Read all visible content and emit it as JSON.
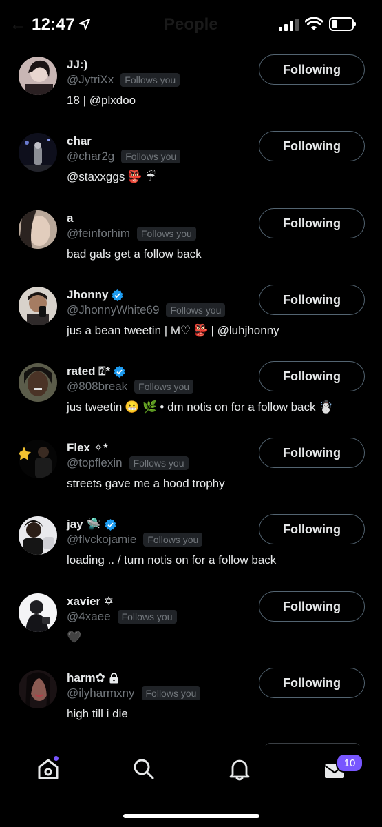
{
  "status_bar": {
    "time": "12:47",
    "title": "People"
  },
  "follow_label": "Following",
  "follows_you_label": "Follows you",
  "people": [
    {
      "name": "JJ:)",
      "handle": "@JytriXx",
      "bio": "18 | @plxdoo",
      "verified": false
    },
    {
      "name": "char",
      "handle": "@char2g",
      "bio": "@staxxggs",
      "bio_emoji": "👺 ☔",
      "verified": false
    },
    {
      "name": "a",
      "handle": "@feinforhim",
      "bio": "bad gals get a follow back",
      "verified": false
    },
    {
      "name": "Jhonny",
      "handle": "@JhonnyWhite69",
      "bio": "jus a bean tweetin | M♡",
      "bio_emoji": "👺",
      "bio_tail": "| @luhjhonny",
      "verified": true
    },
    {
      "name": "rated ⍰*",
      "handle": "@808break",
      "bio": "jus tweetin",
      "bio_emoji": "😬 🌿",
      "bio_tail": "• dm notis on for a follow back ☃️",
      "verified": true
    },
    {
      "name": "Flex ✧*",
      "handle": "@topflexin",
      "bio": "streets gave me a hood trophy",
      "verified": false
    },
    {
      "name": "jay 🛸",
      "handle": "@flvckojamie",
      "bio": "loading .. / turn notis on for a follow back",
      "verified": true
    },
    {
      "name": "xavier ✡",
      "handle": "@4xaee",
      "bio": "🖤",
      "verified": false
    },
    {
      "name": "harm✿",
      "handle": "@ilyharmxny",
      "bio": "high till i die",
      "verified": false,
      "locked": true
    }
  ],
  "tab_bar": {
    "messages_count": "10"
  },
  "colors": {
    "background": "#000000",
    "accent": "#7856ff",
    "verified": "#1d9bf0",
    "muted": "#71767b"
  }
}
